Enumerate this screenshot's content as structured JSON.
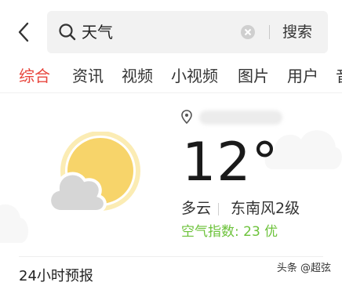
{
  "search": {
    "query": "天气",
    "button_label": "搜索"
  },
  "tabs": [
    {
      "label": "综合",
      "active": true
    },
    {
      "label": "资讯",
      "active": false
    },
    {
      "label": "视频",
      "active": false
    },
    {
      "label": "小视频",
      "active": false
    },
    {
      "label": "图片",
      "active": false
    },
    {
      "label": "用户",
      "active": false
    },
    {
      "label": "音",
      "active": false
    }
  ],
  "weather": {
    "temperature": "12°",
    "condition": "多云",
    "wind": "东南风2级",
    "air_quality": "空气指数: 23 优",
    "icon": "partly-cloudy-icon"
  },
  "section": {
    "hourly_title": "24小时预报"
  },
  "watermark": "头条 @超弦",
  "colors": {
    "accent": "#e8453c",
    "aqi_good": "#6cc23a",
    "sun": "#f7d46a",
    "cloud": "#d6d6d6"
  }
}
